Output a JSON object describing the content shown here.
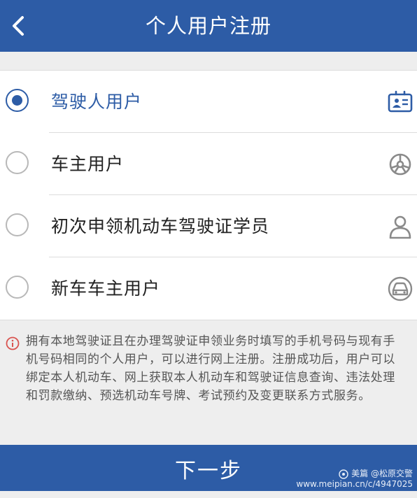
{
  "header": {
    "title": "个人用户注册",
    "back_icon": "chevron-left-icon"
  },
  "options": [
    {
      "label": "驾驶人用户",
      "selected": true,
      "icon": "driver-license-icon"
    },
    {
      "label": "车主用户",
      "selected": false,
      "icon": "steering-wheel-icon"
    },
    {
      "label": "初次申领机动车驾驶证学员",
      "selected": false,
      "icon": "person-icon"
    },
    {
      "label": "新车车主用户",
      "selected": false,
      "icon": "car-icon"
    }
  ],
  "notice": {
    "icon": "info-icon",
    "text": "拥有本地驾驶证且在办理驾驶证申领业务时填写的手机号码与现有手机号码相同的个人用户，可以进行网上注册。注册成功后，用户可以绑定本人机动车、网上获取本人机动车和驾驶证信息查询、违法处理和罚款缴纳、预选机动车号牌、考试预约及变更联系方式服务。"
  },
  "next_button": {
    "label": "下一步"
  },
  "watermark": {
    "line1": "美篇 @松原交警",
    "line2": "www.meipian.cn/c/4947025"
  },
  "colors": {
    "primary": "#2d5ca6",
    "notice_icon": "#d9534f",
    "background": "#eeeeee"
  }
}
